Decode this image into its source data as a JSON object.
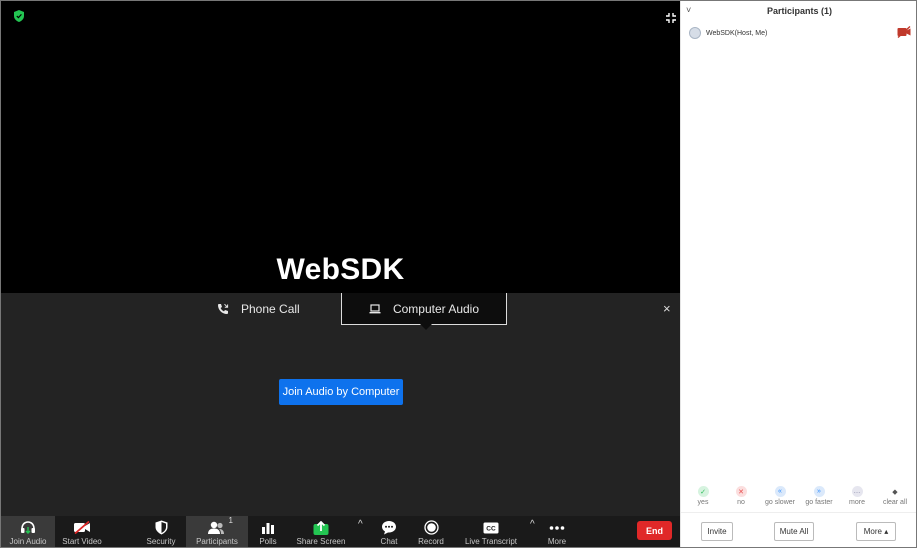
{
  "meeting": {
    "name": "WebSDK",
    "audio_tabs": {
      "phone": "Phone Call",
      "computer": "Computer Audio"
    },
    "join_button": "Join Audio by Computer",
    "close_glyph": "×"
  },
  "toolbar": {
    "join_audio": "Join Audio",
    "start_video": "Start Video",
    "security": "Security",
    "participants": "Participants",
    "participants_count": "1",
    "polls": "Polls",
    "share_screen": "Share Screen",
    "chat": "Chat",
    "record": "Record",
    "live_transcript": "Live Transcript",
    "more": "More",
    "end": "End",
    "caret_glyph": "^"
  },
  "sidebar": {
    "title": "Participants (1)",
    "collapse_glyph": "˅",
    "participant_name": "WebSDK(Host, Me)",
    "feedback": [
      {
        "label": "yes",
        "glyph": "✓",
        "color": "#2dbd5a"
      },
      {
        "label": "no",
        "glyph": "✕",
        "color": "#e84b4b"
      },
      {
        "label": "go slower",
        "glyph": "«",
        "color": "#2d8cff"
      },
      {
        "label": "go faster",
        "glyph": "»",
        "color": "#2d8cff"
      },
      {
        "label": "more",
        "glyph": "…",
        "color": "#7a7a9a"
      },
      {
        "label": "clear all",
        "glyph": "◆",
        "color": "#555555"
      }
    ],
    "invite": "Invite",
    "mute_all": "Mute All",
    "more": "More ▴"
  },
  "colors": {
    "accent": "#0e72ed",
    "end_button": "#e02828",
    "share_screen": "#23c552"
  }
}
